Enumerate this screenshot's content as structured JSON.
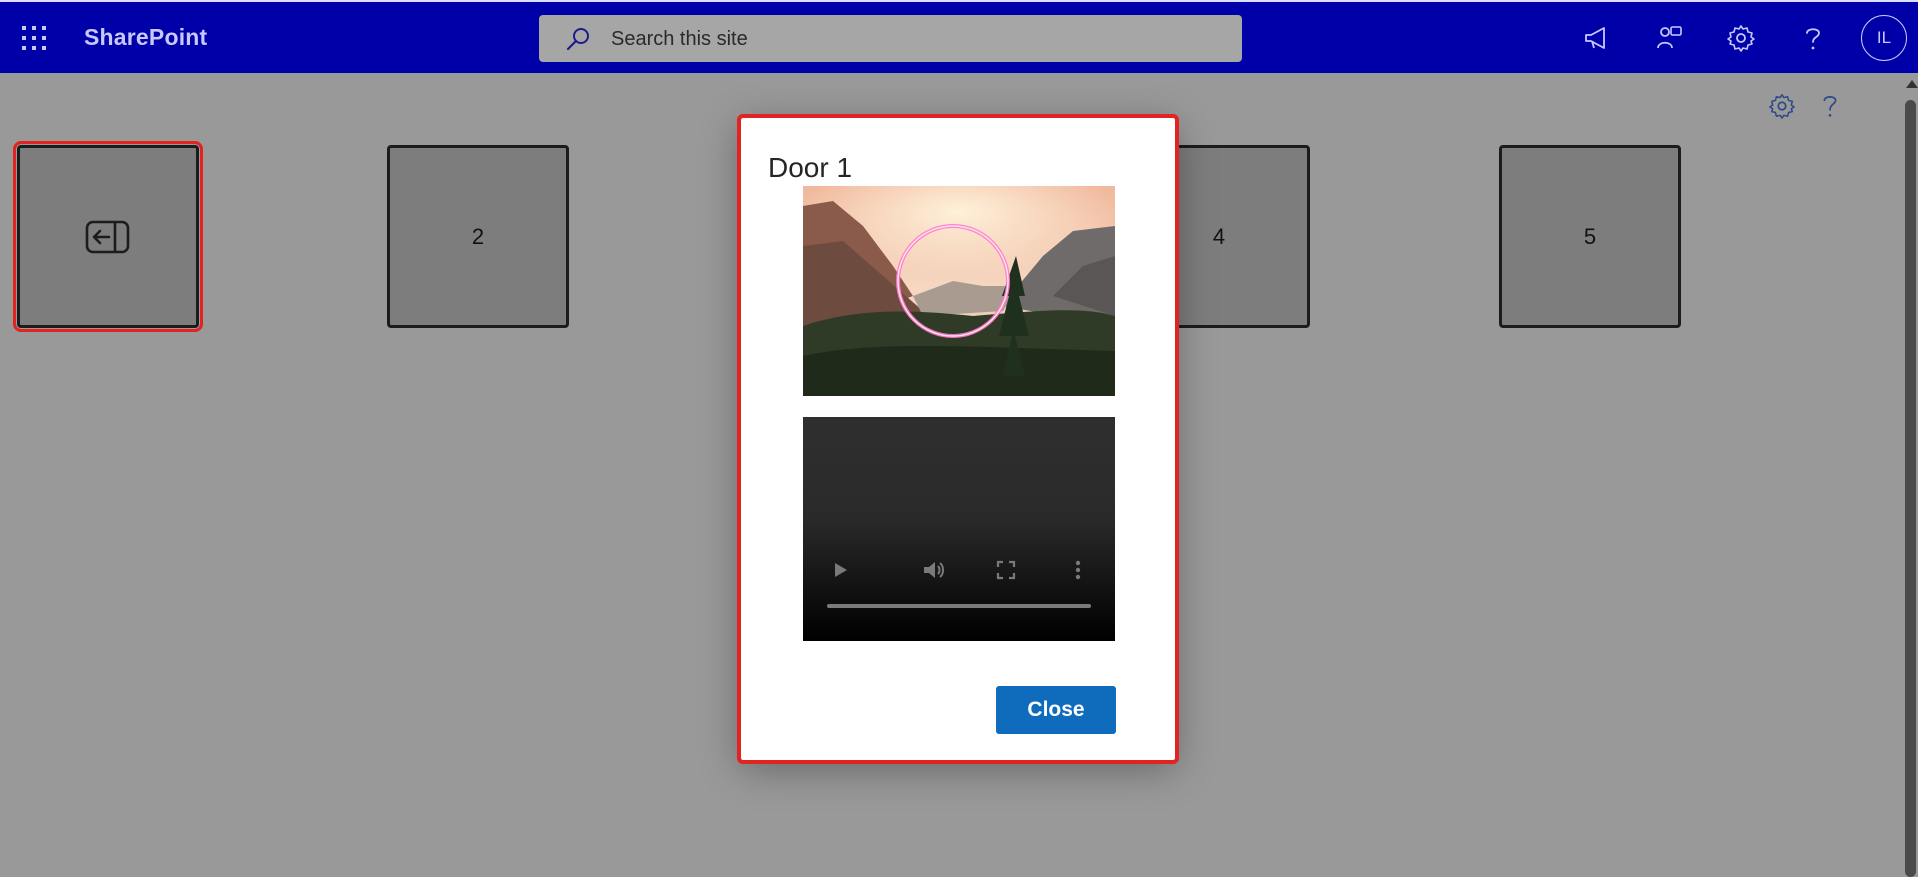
{
  "suitebar": {
    "app_launcher_icon": "waffle-grid-icon",
    "brand": "SharePoint",
    "search": {
      "placeholder": "Search this site",
      "icon": "search-icon"
    },
    "icons": [
      "megaphone-icon",
      "feedback-icon",
      "gear-icon",
      "help-icon"
    ],
    "avatar_initials": "IL"
  },
  "page_toolbar": {
    "icons": [
      "gear-icon",
      "help-icon"
    ]
  },
  "tiles": [
    {
      "label": "",
      "icon": "exit-door-icon",
      "focused": true
    },
    {
      "label": "2"
    },
    {
      "label": "4"
    },
    {
      "label": "5"
    }
  ],
  "dialog": {
    "title": "Door 1",
    "image_alt": "mountain-valley-with-neon-ring",
    "video_controls": [
      "play-icon",
      "volume-icon",
      "fullscreen-icon",
      "more-vertical-icon"
    ],
    "close_label": "Close"
  },
  "colors": {
    "suitebar_bg": "#0000a8",
    "overlay_bg": "#999999",
    "focus_outline": "#e32222",
    "primary_button": "#0f6cbd"
  }
}
